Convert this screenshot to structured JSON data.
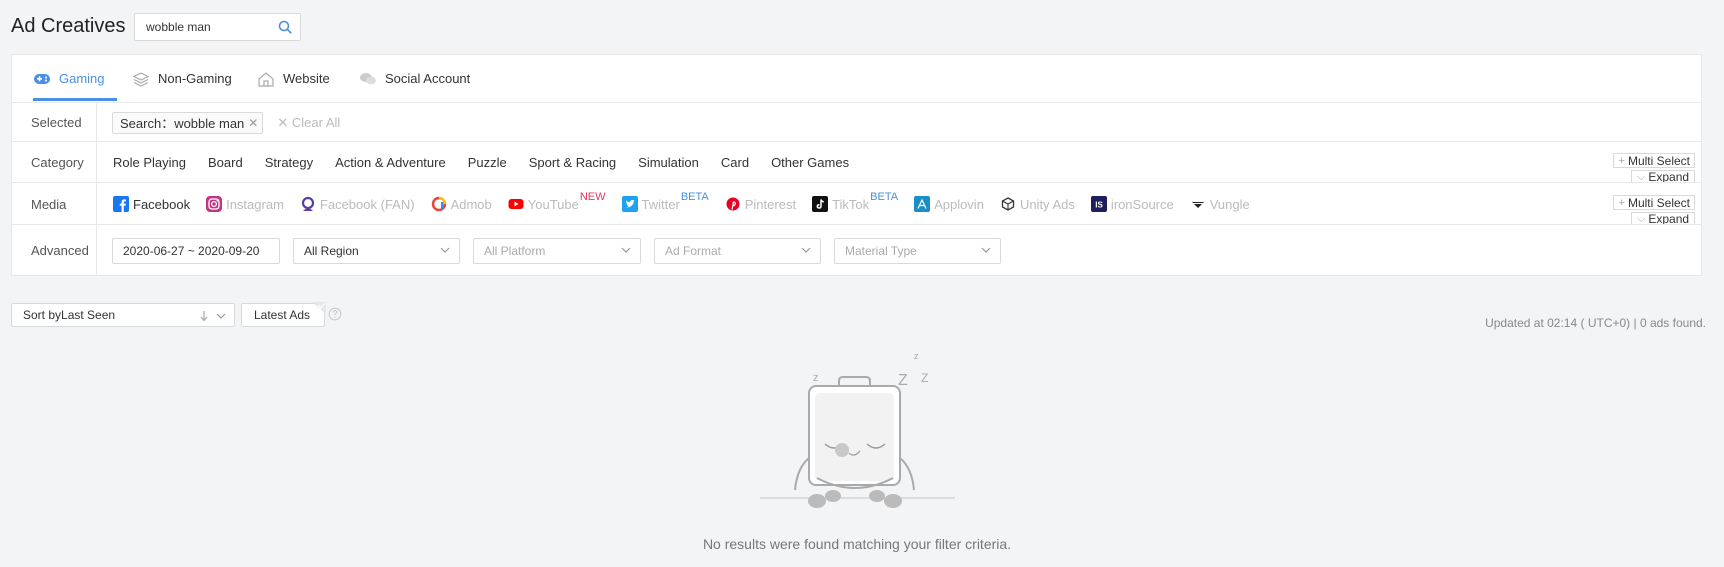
{
  "header": {
    "title": "Ad Creatives",
    "search": {
      "value": "wobble man",
      "placeholder": ""
    }
  },
  "tabs": [
    {
      "label": "Gaming",
      "icon": "gamepad-icon",
      "active": true
    },
    {
      "label": "Non-Gaming",
      "icon": "layers-icon",
      "active": false
    },
    {
      "label": "Website",
      "icon": "home-icon",
      "active": false
    },
    {
      "label": "Social Account",
      "icon": "chat-bubbles-icon",
      "active": false
    }
  ],
  "filters": {
    "selected": {
      "label": "Selected",
      "tag": "Search：wobble man",
      "clear_all": "Clear All"
    },
    "category": {
      "label": "Category",
      "items": [
        "Role Playing",
        "Board",
        "Strategy",
        "Action & Adventure",
        "Puzzle",
        "Sport & Racing",
        "Simulation",
        "Card",
        "Other Games"
      ],
      "multi_select": "Multi Select",
      "expand": "Expand"
    },
    "media": {
      "label": "Media",
      "items": [
        {
          "label": "Facebook",
          "icon": "facebook-icon",
          "active": true,
          "badge": ""
        },
        {
          "label": "Instagram",
          "icon": "instagram-icon",
          "active": false,
          "badge": ""
        },
        {
          "label": "Facebook (FAN)",
          "icon": "facebook-fan-icon",
          "active": false,
          "badge": ""
        },
        {
          "label": "Admob",
          "icon": "admob-icon",
          "active": false,
          "badge": ""
        },
        {
          "label": "YouTube",
          "icon": "youtube-icon",
          "active": false,
          "badge": "NEW"
        },
        {
          "label": "Twitter",
          "icon": "twitter-icon",
          "active": false,
          "badge": "BETA"
        },
        {
          "label": "Pinterest",
          "icon": "pinterest-icon",
          "active": false,
          "badge": ""
        },
        {
          "label": "TikTok",
          "icon": "tiktok-icon",
          "active": false,
          "badge": "BETA"
        },
        {
          "label": "Applovin",
          "icon": "applovin-icon",
          "active": false,
          "badge": ""
        },
        {
          "label": "Unity Ads",
          "icon": "unity-icon",
          "active": false,
          "badge": ""
        },
        {
          "label": "ironSource",
          "icon": "ironsource-icon",
          "active": false,
          "badge": ""
        },
        {
          "label": "Vungle",
          "icon": "vungle-icon",
          "active": false,
          "badge": ""
        }
      ],
      "multi_select": "Multi Select",
      "expand": "Expand"
    },
    "advanced": {
      "label": "Advanced",
      "date_range": "2020-06-27 ~ 2020-09-20",
      "region": "All Region",
      "platform": "All Platform",
      "ad_format": "Ad Format",
      "material_type": "Material Type"
    }
  },
  "toolbar": {
    "sort_prefix": "Sort by",
    "sort_value": "Last Seen",
    "latest_ads": "Latest Ads",
    "updated_text": "Updated at 02:14 ( UTC+0) | 0 ads found."
  },
  "empty_state": {
    "message": "No results were found matching your filter criteria."
  },
  "colors": {
    "accent": "#4a90e2",
    "new_badge": "#e8335b",
    "facebook": "#1877f2",
    "instagram": "#c13584",
    "youtube": "#ff0000",
    "twitter": "#1da1f2",
    "pinterest": "#e60023",
    "ironsource": "#1d1f5c"
  }
}
